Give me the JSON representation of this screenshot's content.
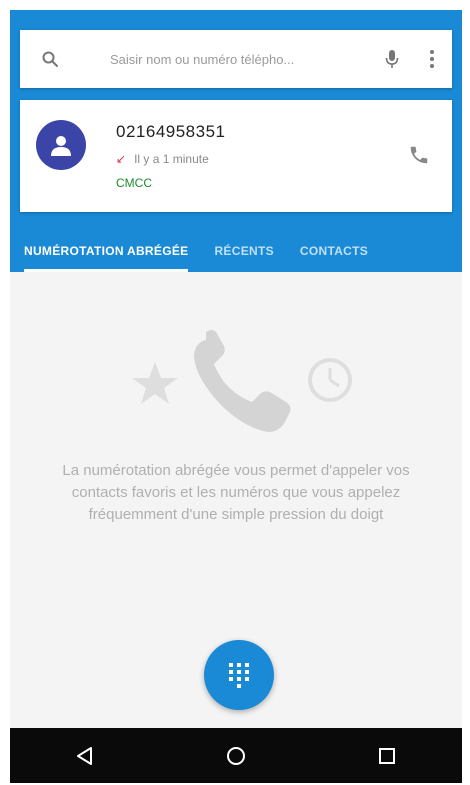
{
  "search": {
    "placeholder": "Saisir nom ou numéro télépho...",
    "icon": "search-icon",
    "mic_icon": "mic-icon",
    "more_icon": "more-vert-icon"
  },
  "recent_call": {
    "number": "02164958351",
    "time": "Il y a 1 minute",
    "carrier": "CMCC",
    "call_type": "missed",
    "avatar_icon": "person-icon",
    "action_icon": "phone-icon"
  },
  "tabs": [
    {
      "label": "NUMÉROTATION ABRÉGÉE",
      "active": true
    },
    {
      "label": "RÉCENTS",
      "active": false
    },
    {
      "label": "CONTACTS",
      "active": false
    }
  ],
  "empty_state": {
    "message": "La numérotation abrégée vous permet d'appeler vos contacts favoris et les numéros que vous appelez fréquemment d'une simple pression du doigt",
    "icons": [
      "star-icon",
      "phone-icon",
      "clock-icon"
    ]
  },
  "fab": {
    "icon": "dialpad-icon"
  },
  "navbar": {
    "icons": [
      "back-icon",
      "home-icon",
      "recents-icon"
    ]
  },
  "colors": {
    "primary": "#1a8ad6",
    "avatar": "#3b45a8",
    "missed": "#d9364b",
    "carrier": "#1c8c2e"
  }
}
